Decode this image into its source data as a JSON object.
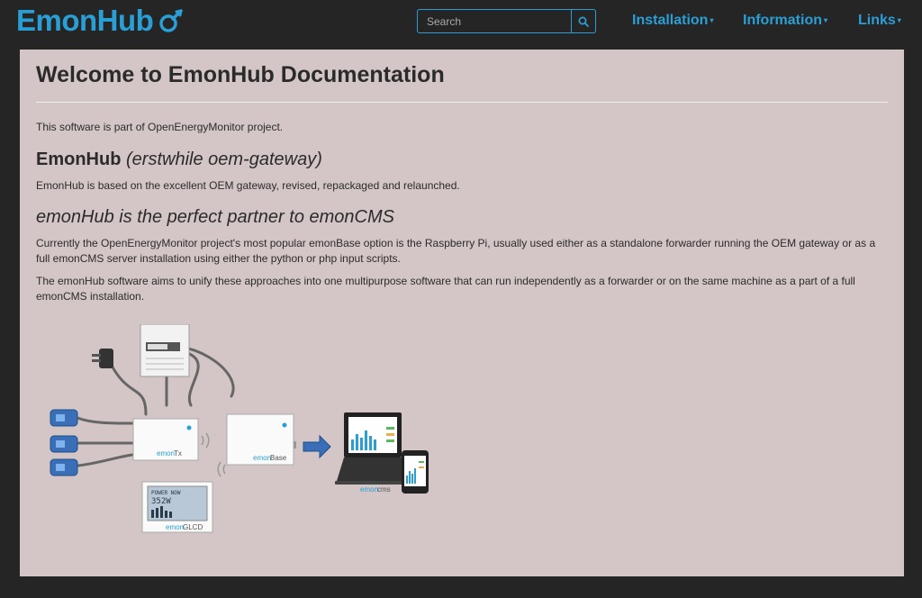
{
  "navbar": {
    "brand": "EmonHub",
    "search_placeholder": "Search",
    "menu": [
      {
        "label": "Installation"
      },
      {
        "label": "Information"
      },
      {
        "label": "Links"
      }
    ]
  },
  "page": {
    "title": "Welcome to EmonHub Documentation",
    "intro": "This software is part of OpenEnergyMonitor project.",
    "section1": {
      "heading": "EmonHub",
      "heading_italic": "(erstwhile oem-gateway)",
      "text": "EmonHub is based on the excellent OEM gateway, revised, repackaged and relaunched."
    },
    "section2": {
      "heading": "emonHub is the perfect partner to emonCMS",
      "para1": "Currently the OpenEnergyMonitor project's most popular emonBase option is the Raspberry Pi, usually used either as a standalone forwarder running the OEM gateway or as a full emonCMS server installation using either the python or php input scripts.",
      "para2": "The emonHub software aims to unify these approaches into one multipurpose software that can run independently as a forwarder or on the same machine as a part of a full emonCMS installation."
    }
  },
  "diagram": {
    "emontx_prefix": "emon",
    "emontx_suffix": "Tx",
    "emonbase_prefix": "emon",
    "emonbase_suffix": "Base",
    "emoncms_prefix": "emon",
    "emoncms_suffix": "cms",
    "emonglcd_prefix": "emon",
    "emonglcd_suffix": "GLCD",
    "glcd_line1": "POWER NOW",
    "glcd_line2": "352W"
  },
  "colors": {
    "brand": "#2a9fd6",
    "navbar_bg": "#252525",
    "panel_bg": "#d4c6c6",
    "text": "#2b2b2b"
  },
  "icons": {
    "brand_logo": "oem-gauge-icon",
    "search": "search-icon",
    "caret": "caret-down-icon"
  }
}
